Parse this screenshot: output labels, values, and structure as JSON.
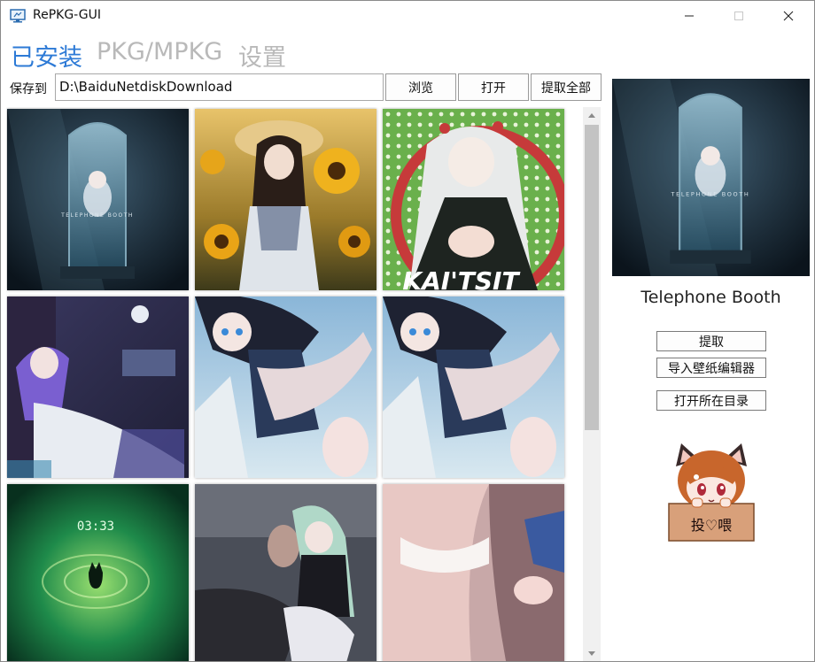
{
  "window": {
    "title": "RePKG-GUI"
  },
  "nav": {
    "tabs": [
      {
        "label": "已安装",
        "active": true
      },
      {
        "label": "PKG/MPKG",
        "active": false
      },
      {
        "label": "设置",
        "active": false
      }
    ]
  },
  "toolbar": {
    "save_label": "保存到",
    "save_path": "D:\\BaiduNetdiskDownload",
    "browse_label": "浏览",
    "open_label": "打开",
    "extract_all_label": "提取全部"
  },
  "grid": {
    "items": [
      {
        "overlay_text": "TELEPHONE BOOTH"
      },
      {
        "overlay_text": ""
      },
      {
        "overlay_text": "KAI'TSIT"
      },
      {
        "overlay_text": ""
      },
      {
        "overlay_text": ""
      },
      {
        "overlay_text": ""
      },
      {
        "overlay_text": "03:33"
      },
      {
        "overlay_text": ""
      },
      {
        "overlay_text": ""
      }
    ]
  },
  "scrollbar": {
    "position": 0.0
  },
  "details": {
    "title": "Telephone Booth",
    "preview_overlay_text": "TELEPHONE BOOTH",
    "extract_label": "提取",
    "import_label": "导入壁纸编辑器",
    "open_dir_label": "打开所在目录"
  },
  "donate": {
    "label": "投♡喂"
  },
  "colors": {
    "accent": "#2d7ad6",
    "inactive_tab": "#b9b9b9"
  }
}
